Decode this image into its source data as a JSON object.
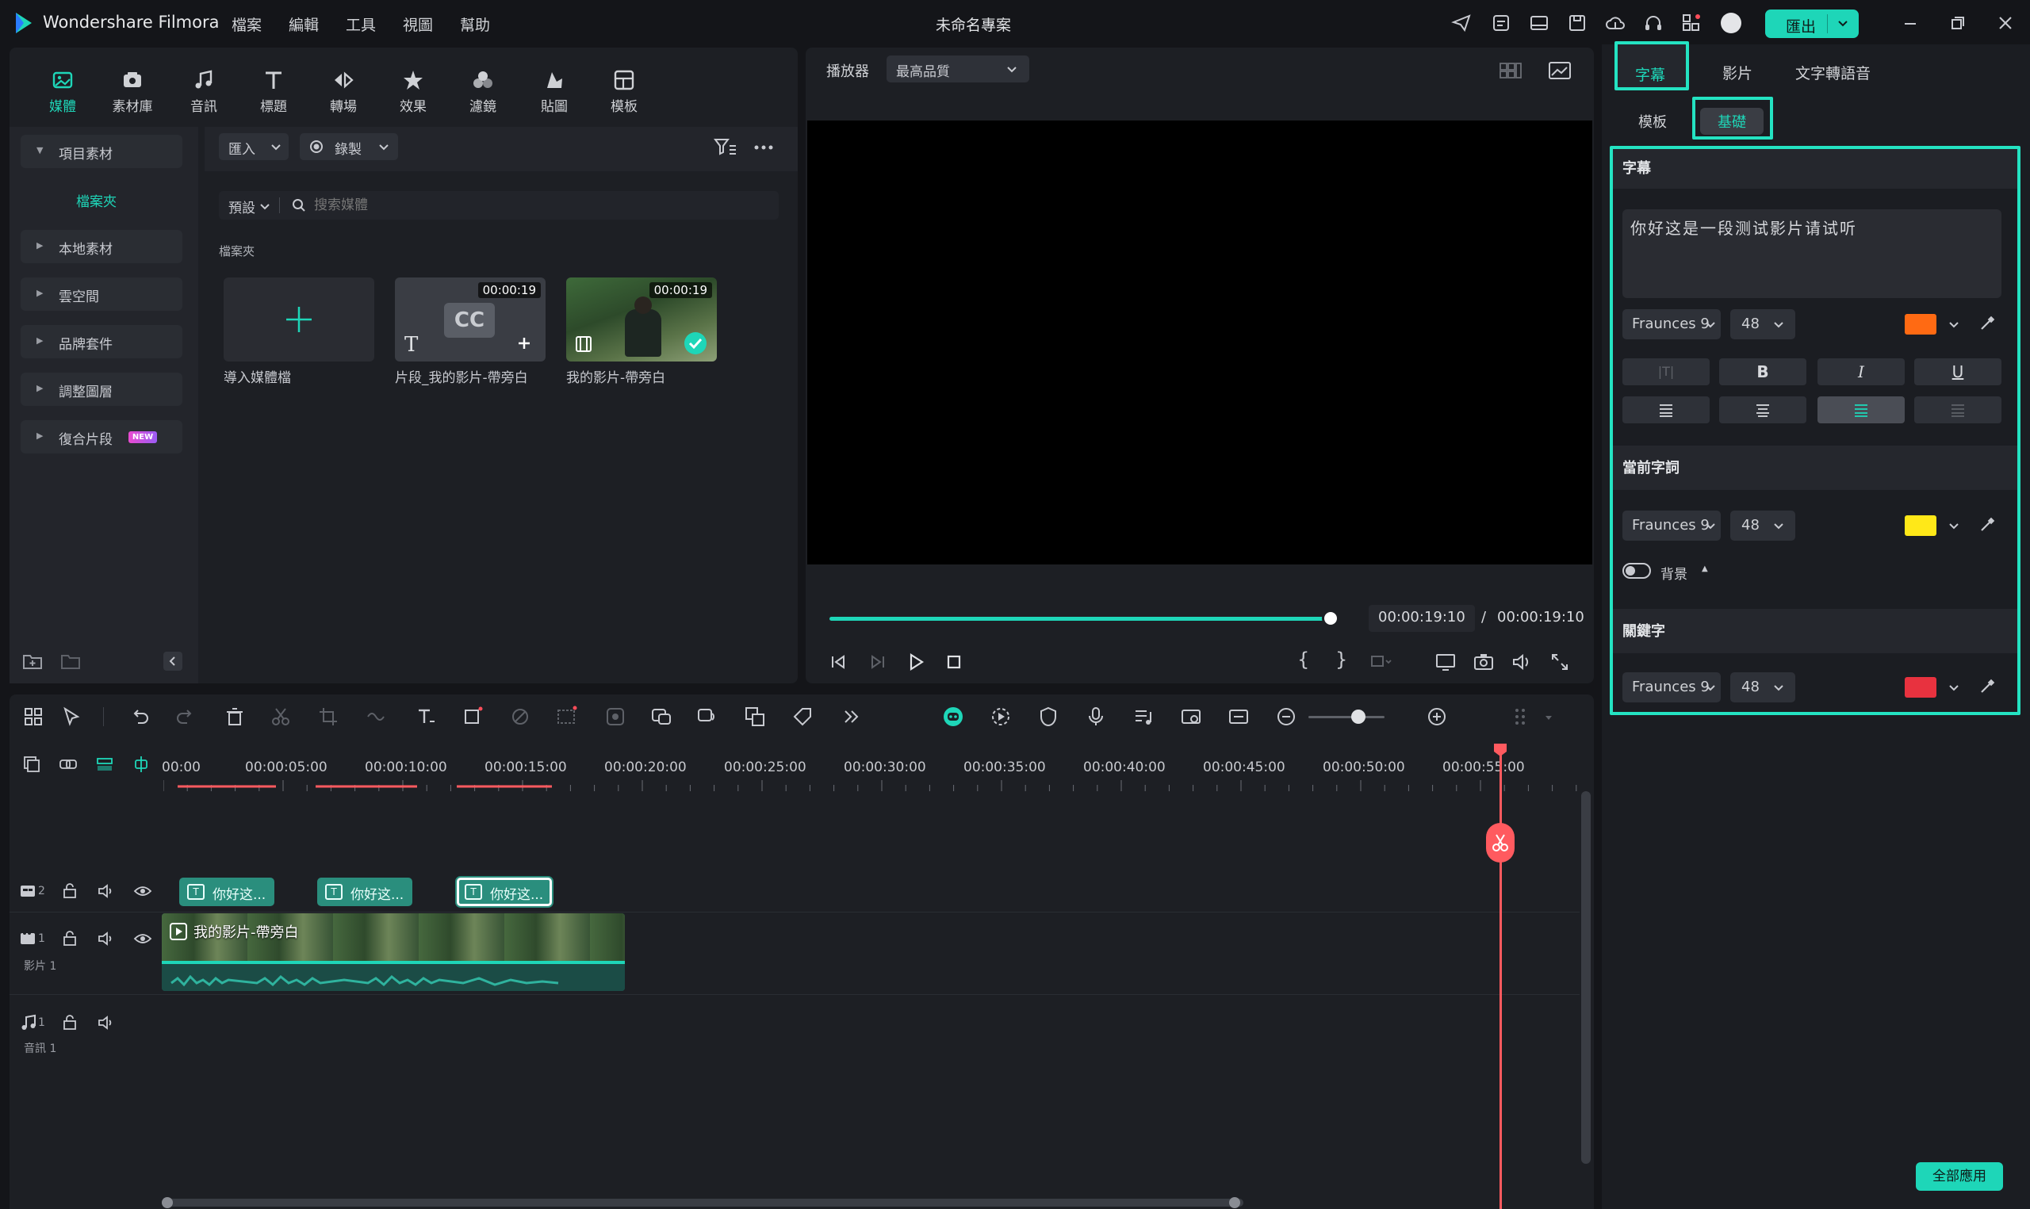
{
  "app": {
    "name": "Wondershare Filmora",
    "project_title": "未命名專案",
    "menu": [
      "檔案",
      "編輯",
      "工具",
      "視圖",
      "幫助"
    ],
    "export_label": "匯出"
  },
  "media_tabs": [
    {
      "label": "媒體",
      "icon": "media-icon"
    },
    {
      "label": "素材庫",
      "icon": "stock-icon"
    },
    {
      "label": "音訊",
      "icon": "music-icon"
    },
    {
      "label": "標題",
      "icon": "title-icon"
    },
    {
      "label": "轉場",
      "icon": "transition-icon"
    },
    {
      "label": "效果",
      "icon": "effects-icon"
    },
    {
      "label": "濾鏡",
      "icon": "filters-icon"
    },
    {
      "label": "貼圖",
      "icon": "stickers-icon"
    },
    {
      "label": "模板",
      "icon": "templates-icon"
    }
  ],
  "sidebar": {
    "project_assets": "項目素材",
    "folder": "檔案夾",
    "items": [
      "本地素材",
      "雲空間",
      "品牌套件",
      "調整圖層",
      "復合片段"
    ],
    "new_badge": "NEW"
  },
  "media": {
    "import_label": "匯入",
    "record_label": "錄製",
    "sort_label": "預設",
    "search_placeholder": "搜索媒體",
    "folder_label": "檔案夾",
    "items": [
      {
        "caption": "導入媒體檔",
        "duration": ""
      },
      {
        "caption": "片段_我的影片-帶旁白",
        "duration": "00:00:19"
      },
      {
        "caption": "我的影片-帶旁白",
        "duration": "00:00:19"
      }
    ]
  },
  "player": {
    "label": "播放器",
    "quality": "最高品質",
    "current_time": "00:00:19:10",
    "separator": "/",
    "total_time": "00:00:19:10",
    "progress": 0.985
  },
  "right_panel": {
    "tabs": [
      "字幕",
      "影片",
      "文字轉語音"
    ],
    "sub_tabs": [
      "模板",
      "基礎"
    ],
    "subtitle_section": "字幕",
    "subtitle_text": "你好这是一段测试影片请试听",
    "font": "Fraunces 9",
    "font_size": "48",
    "subtitle_color": "#ff6a13",
    "current_word_section": "當前字詞",
    "current_word_color": "#ffe818",
    "background_label": "背景",
    "keyword_section": "關鍵字",
    "keyword_color": "#e8323f",
    "bold": "B",
    "italic": "I",
    "underline": "U",
    "apply_all": "全部應用"
  },
  "timeline": {
    "ruler": [
      "00:00",
      "00:00:05:00",
      "00:00:10:00",
      "00:00:15:00",
      "00:00:20:00",
      "00:00:25:00",
      "00:00:30:00",
      "00:00:35:00",
      "00:00:40:00",
      "00:00:45:00",
      "00:00:50:00",
      "00:00:55:00"
    ],
    "subtitle_clips": [
      "你好这...",
      "你好这...",
      "你好这..."
    ],
    "video_clip": "我的影片-帶旁白",
    "tracks": [
      {
        "num": "2",
        "label": ""
      },
      {
        "num": "1",
        "label": "影片 1"
      },
      {
        "num": "1",
        "label": "音訊 1"
      }
    ]
  },
  "colors": {
    "accent": "#1ed6b8",
    "highlight": "#24e3c2",
    "playhead": "#ff5a5f"
  }
}
